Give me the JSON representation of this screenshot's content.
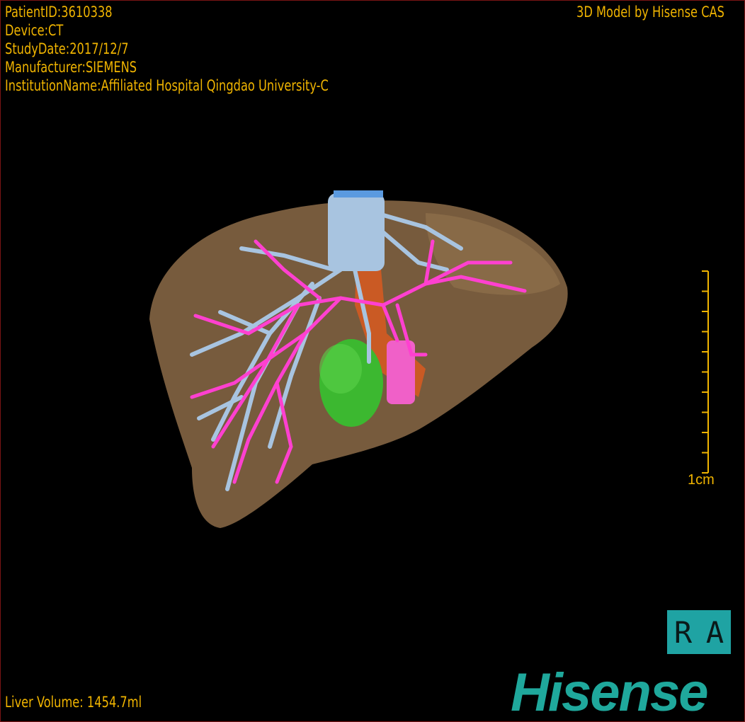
{
  "patient_info": {
    "patient_id": "PatientID:3610338",
    "device": "Device:CT",
    "study_date": "StudyDate:2017/12/7",
    "manufacturer": "Manufacturer:SIEMENS",
    "institution": "InstitutionName:Affiliated Hospital Qingdao University-C"
  },
  "credit": "3D Model by Hisense CAS",
  "liver_volume": "Liver Volume: 1454.7ml",
  "scale_bar": {
    "label": "1cm",
    "ticks": 11
  },
  "orientation": {
    "left": "R",
    "right": "A"
  },
  "logo": "Hisense",
  "colors": {
    "text": "#f0b400",
    "liver": "#8a6a40",
    "hepatic_vein": "#a8c4e0",
    "portal_vein": "#ff40d0",
    "ivc": "#e06020",
    "tumor": "#3cb830",
    "orientation_bg": "#1fa3a3",
    "logo": "#1fa89c"
  }
}
